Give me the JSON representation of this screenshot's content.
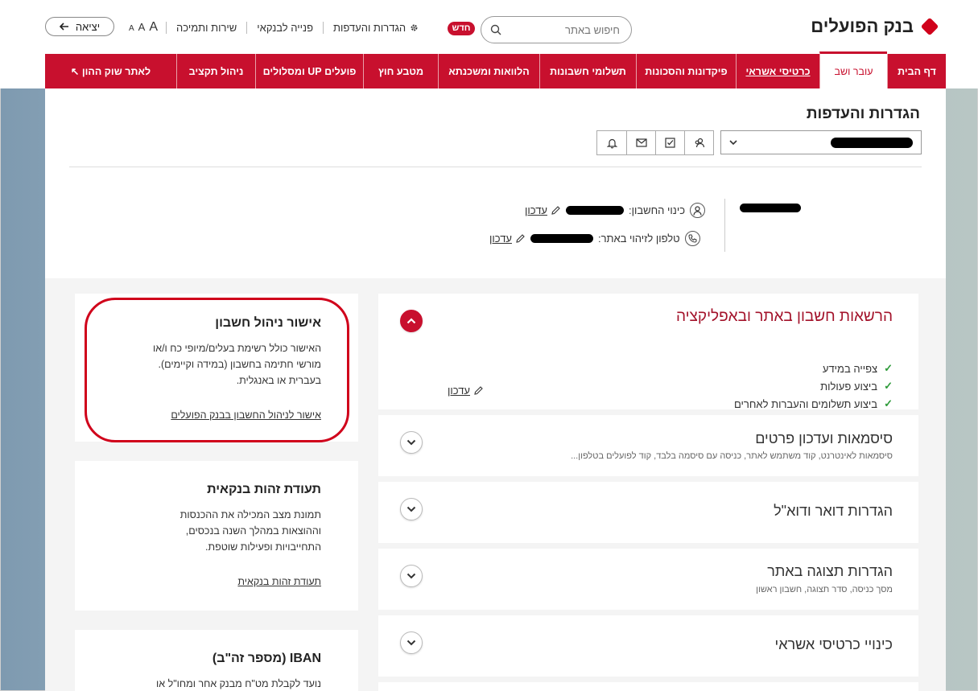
{
  "header": {
    "logo_text": "בנק הפועלים",
    "search_placeholder": "חיפוש באתר",
    "new_badge": "חדש",
    "util_links": [
      "הגדרות והעדפות",
      "פנייה לבנקאי",
      "שירות ותמיכה"
    ],
    "font_sizes": [
      "A",
      "A",
      "A"
    ],
    "exit_label": "יציאה"
  },
  "nav": {
    "items": [
      {
        "label": "דף הבית",
        "active": false
      },
      {
        "label": "עובר ושב",
        "active": true
      },
      {
        "label": "כרטיסי אשראי",
        "active": false
      },
      {
        "label": "פיקדונות והסכונות",
        "active": false
      },
      {
        "label": "תשלומי חשבונות",
        "active": false
      },
      {
        "label": "הלוואות ומשכנתא",
        "active": false
      },
      {
        "label": "מטבע חוץ",
        "active": false
      },
      {
        "label": "פועלים UP ומסלולים",
        "active": false
      },
      {
        "label": "ניהול תקציב",
        "active": false
      },
      {
        "label": "לאתר שוק ההון ↖",
        "active": false
      }
    ]
  },
  "settings": {
    "title": "הגדרות והעדפות",
    "account_nickname_label": "כינוי החשבון:",
    "phone_label": "טלפון לזיהוי באתר:",
    "edit_label": "עדכון"
  },
  "sidebar": {
    "cards": [
      {
        "title": "אישור ניהול חשבון",
        "body": [
          "האישור כולל רשימת בעלים/מיופי כח ו/או",
          "מורשי חתימה בחשבון (במידה וקיימים).",
          "בעברית או באנגלית."
        ],
        "link": "אישור לניהול החשבון בבנק הפועלים"
      },
      {
        "title": "תעודת זהות בנקאית",
        "body": [
          "תמונת מצב המכילה את ההכנסות",
          "וההוצאות במהלך השנה בנכסים,",
          "התחייבויות ופעילות שוטפת."
        ],
        "link": "תעודת זהות בנקאית"
      },
      {
        "title": "IBAN (מספר זה\"ב)",
        "body": [
          "נועד לקבלת מט\"ח מבנק אחר ומחו\"ל או"
        ],
        "link": ""
      }
    ]
  },
  "accordion": {
    "sections": [
      {
        "title": "הרשאות חשבון באתר ובאפליקציה",
        "subtitle": "",
        "open": true,
        "permissions": [
          "צפייה במידע",
          "ביצוע פעולות",
          "ביצוע תשלומים והעברות לאחרים"
        ],
        "edit_label": "עדכון"
      },
      {
        "title": "סיסמאות ועדכון פרטים",
        "subtitle": "סיסמאות לאינטרנט, קוד משתמש לאתר, כניסה עם סיסמה בלבד, קוד לפועלים בטלפון...",
        "open": false
      },
      {
        "title": "הגדרות דואר ודוא\"ל",
        "subtitle": "",
        "open": false
      },
      {
        "title": "הגדרות תצוגה באתר",
        "subtitle": "מסך כניסה, סדר תצוגה, חשבון ראשון",
        "open": false
      },
      {
        "title": "כינויי כרטיסי אשראי",
        "subtitle": "",
        "open": false
      }
    ]
  },
  "colors": {
    "brand_red": "#c8102e",
    "check_green": "#2e9b3a"
  }
}
